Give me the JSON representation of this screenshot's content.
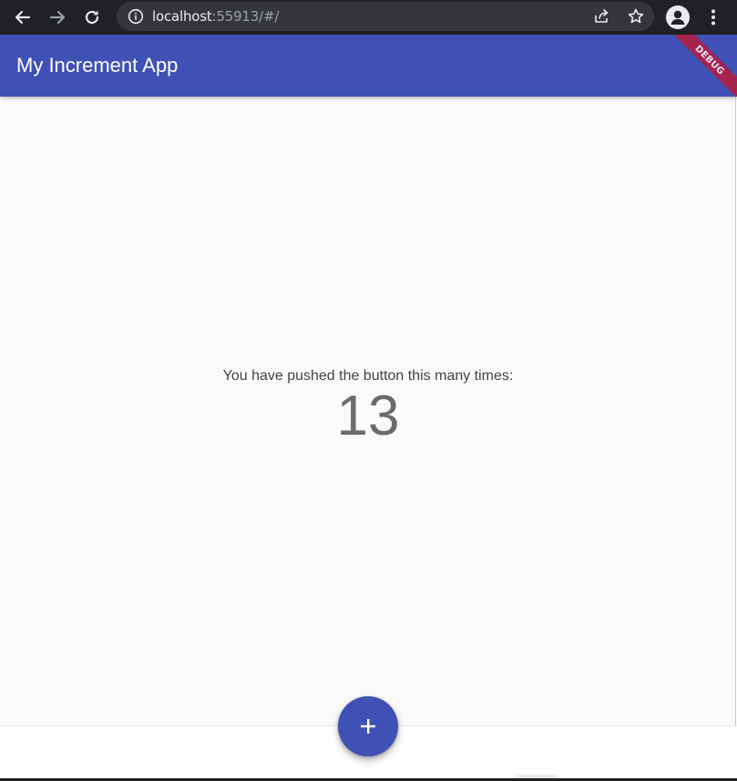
{
  "browser": {
    "url_host": "localhost",
    "url_rest": ":55913/#/"
  },
  "app_bar": {
    "title": "My Increment App",
    "debug_banner": "DEBUG",
    "color": "#3f51b5"
  },
  "main": {
    "counter_label": "You have pushed the button this many times:",
    "counter_value": "13"
  },
  "fab": {
    "icon": "add-icon",
    "glyph": "+"
  }
}
